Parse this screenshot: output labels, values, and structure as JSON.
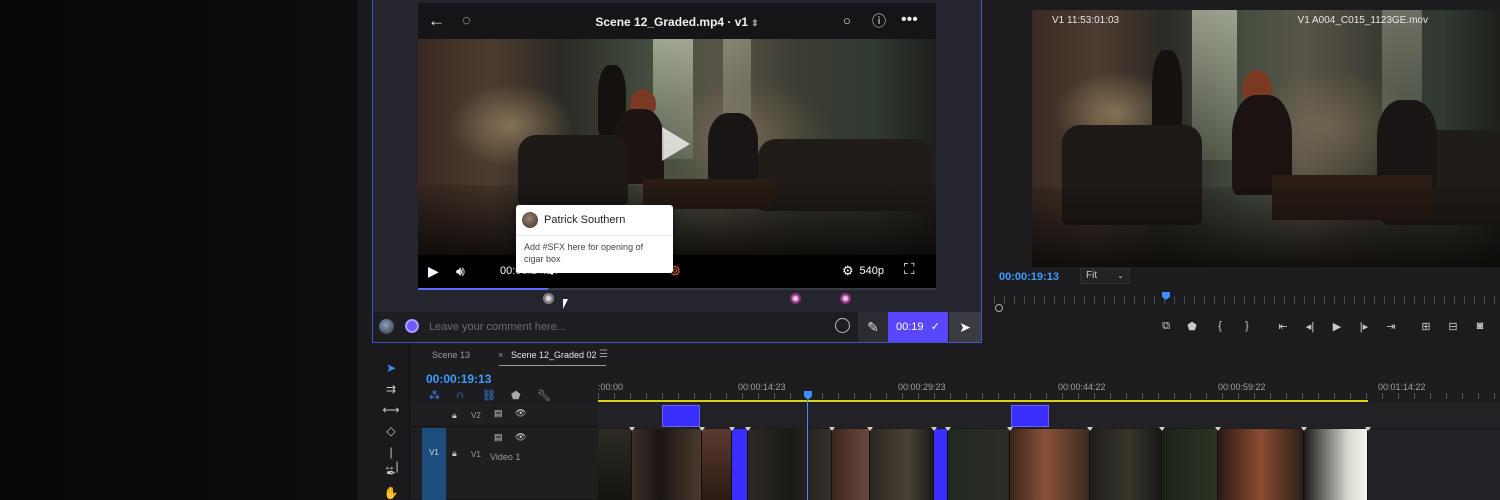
{
  "colors": {
    "accent_blue": "#3e8cff",
    "frameio_purple": "#5847ff",
    "comment_clip": "#3a2eff",
    "work_area": "#d8d21a"
  },
  "frameio": {
    "title": "Scene 12_Graded.mp4 · v1",
    "header_icons": [
      "back-arrow-icon",
      "comment-bubble-icon",
      "circle-icon",
      "info-icon",
      "more-icon"
    ],
    "timecode": "00:00:14:14",
    "quality": "540p",
    "comment_popup": {
      "author": "Patrick Southern",
      "body": "Add #SFX here for opening of cigar box"
    },
    "comment_input_placeholder": "Leave your comment here...",
    "timecode_button": "00:19"
  },
  "program_monitor": {
    "timecode_top": "V1 11:53:01:03",
    "clip_name": "V1 A004_C015_1123GE.mov",
    "playhead_timecode": "00:00:19:13",
    "zoom": "Fit"
  },
  "timeline": {
    "tabs": [
      {
        "label": "Scene 13"
      },
      {
        "label": "Scene 12_Graded 02"
      }
    ],
    "timecode": "00:00:19:13",
    "ruler_labels": [
      ":00:00",
      "00:00:14:23",
      "00:00:29:23",
      "00:00:44:22",
      "00:00:59:22",
      "00:01:14:22"
    ],
    "tracks": {
      "v2": {
        "label": "V2"
      },
      "v1": {
        "target": "V1",
        "label": "V1",
        "name": "Video 1"
      }
    }
  }
}
